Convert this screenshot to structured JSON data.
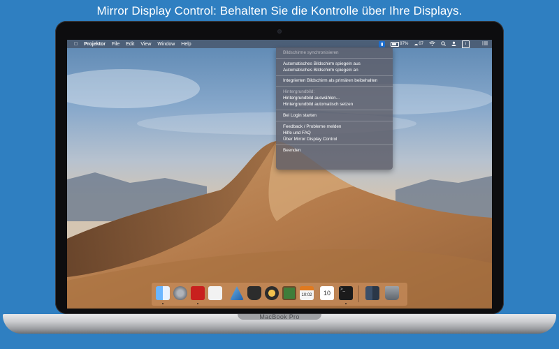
{
  "headline": "Mirror Display Control: Behalten Sie die Kontrolle über Ihre Displays.",
  "laptop": {
    "model_label": "MacBook Pro"
  },
  "menubar": {
    "app_name": "Projektor",
    "items": [
      "File",
      "Edit",
      "View",
      "Window",
      "Help"
    ],
    "status": {
      "battery_text": "97%",
      "cloud_text": "07"
    }
  },
  "dropdown": {
    "sync_header": "Bildschirme synchronisieren",
    "mirror_off": "Automatisches Bildschirm spiegeln aus",
    "mirror_on": "Automatisches Bildschirm spiegeln an",
    "keep_primary": "Integrierten Bildschirm als primären beibehalten",
    "wallpaper_header": "Hintergrundbild:",
    "wallpaper_choose": "Hintergrundbild auswählen...",
    "wallpaper_auto": "Hintergrundbild automatisch setzen",
    "login_start": "Bei Login starten",
    "feedback": "Feedback / Probleme melden",
    "help_faq": "Hilfe und FAQ",
    "about": "Über Mirror Display Control",
    "quit": "Beenden"
  },
  "dock": {
    "clock_text": "10:02",
    "calendar_day": "10"
  },
  "colors": {
    "background": "#2f7fc1",
    "menu_accent": "#1e6fd0"
  },
  "icons": [
    "apple-icon",
    "mirror-display-icon",
    "battery-icon",
    "cloud-icon",
    "wifi-icon",
    "search-icon",
    "user-icon",
    "notification-center-icon"
  ]
}
